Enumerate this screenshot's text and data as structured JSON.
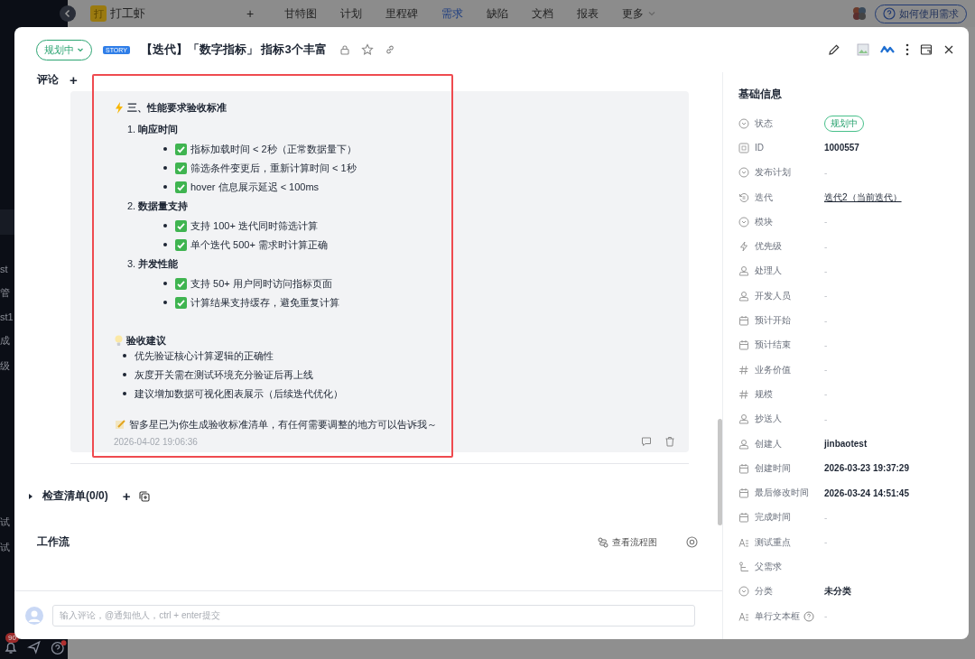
{
  "sidebar": {
    "items": [
      "st",
      "管",
      "st1",
      "成",
      "级",
      "试",
      "试"
    ],
    "notification_count": "90"
  },
  "topbar": {
    "logo_mark": "打",
    "app_name": "打工虾",
    "add": "+",
    "nav": [
      {
        "label": "甘特图",
        "selected": false
      },
      {
        "label": "计划",
        "selected": false
      },
      {
        "label": "里程碑",
        "selected": false
      },
      {
        "label": "需求",
        "selected": true
      },
      {
        "label": "缺陷",
        "selected": false
      },
      {
        "label": "文档",
        "selected": false
      },
      {
        "label": "报表",
        "selected": false
      },
      {
        "label": "更多",
        "selected": false
      }
    ],
    "help_button": "如何使用需求"
  },
  "dialog": {
    "status": "规划中",
    "type_badge": "STORY",
    "title": "【迭代】「数字指标」 指标3个丰富",
    "comments_label": "评论",
    "add_comment": "+",
    "comment": {
      "blocks": [
        {
          "kind": "perf-heading",
          "text": "三、性能要求验收标准"
        },
        {
          "kind": "numbered",
          "number": "1.",
          "text": "响应时间"
        },
        {
          "kind": "check",
          "text": "指标加载时间 < 2秒（正常数据量下）"
        },
        {
          "kind": "check",
          "text": "筛选条件变更后，重新计算时间 < 1秒"
        },
        {
          "kind": "check",
          "text": "hover 信息展示延迟 < 100ms"
        },
        {
          "kind": "numbered",
          "number": "2.",
          "text": "数据量支持"
        },
        {
          "kind": "check",
          "text": "支持 100+ 迭代同时筛选计算"
        },
        {
          "kind": "check",
          "text": "单个迭代 500+ 需求时计算正确"
        },
        {
          "kind": "numbered",
          "number": "3.",
          "text": "并发性能"
        },
        {
          "kind": "check",
          "text": "支持 50+ 用户同时访问指标页面"
        },
        {
          "kind": "check",
          "text": "计算结果支持缓存，避免重复计算"
        },
        {
          "kind": "tip-heading",
          "text": "验收建议"
        },
        {
          "kind": "bullet",
          "text": "优先验证核心计算逻辑的正确性"
        },
        {
          "kind": "bullet",
          "text": "灰度开关需在测试环境充分验证后再上线"
        },
        {
          "kind": "bullet",
          "text": "建议增加数据可视化图表展示（后续迭代优化）"
        },
        {
          "kind": "closing",
          "text": "智多星已为你生成验收标准清单，有任何需要调整的地方可以告诉我～"
        }
      ],
      "timestamp": "2026-04-02 19:06:36"
    },
    "checklist": {
      "label": "检查清单(0/0)",
      "expanded": false,
      "add": "+"
    },
    "workflow": {
      "label": "工作流",
      "view_chart": "查看流程图"
    },
    "comment_input": {
      "placeholder": "输入评论，@通知他人，ctrl + enter提交"
    },
    "info": {
      "title": "基础信息",
      "fields": [
        {
          "kind": "status",
          "label": "状态",
          "value": "规划中"
        },
        {
          "kind": "id",
          "label": "ID",
          "value": "1000557"
        },
        {
          "kind": "select",
          "label": "发布计划",
          "placeholder": "-"
        },
        {
          "kind": "iteration",
          "label": "迭代",
          "value": "迭代2（当前迭代）"
        },
        {
          "kind": "select",
          "label": "模块",
          "placeholder": "-"
        },
        {
          "kind": "priority",
          "label": "优先级",
          "placeholder": "-"
        },
        {
          "kind": "user",
          "label": "处理人",
          "placeholder": "-"
        },
        {
          "kind": "user",
          "label": "开发人员",
          "placeholder": "-"
        },
        {
          "kind": "date",
          "label": "预计开始",
          "placeholder": "-"
        },
        {
          "kind": "date",
          "label": "预计结束",
          "placeholder": "-"
        },
        {
          "kind": "number",
          "label": "业务价值",
          "placeholder": "-"
        },
        {
          "kind": "number",
          "label": "规模",
          "placeholder": "-"
        },
        {
          "kind": "user",
          "label": "抄送人",
          "placeholder": "-"
        },
        {
          "kind": "user",
          "label": "创建人",
          "value": "jinbaotest"
        },
        {
          "kind": "date",
          "label": "创建时间",
          "value": "2026-03-23 19:37:29"
        },
        {
          "kind": "date",
          "label": "最后修改时间",
          "value": "2026-03-24 14:51:45"
        },
        {
          "kind": "date",
          "label": "完成时间",
          "placeholder": "-"
        },
        {
          "kind": "text",
          "label": "测试重点",
          "placeholder": "-"
        },
        {
          "kind": "parent",
          "label": "父需求"
        },
        {
          "kind": "select",
          "label": "分类",
          "value": "未分类"
        },
        {
          "kind": "text",
          "label": "单行文本框",
          "placeholder": "-",
          "help": true
        }
      ]
    }
  }
}
